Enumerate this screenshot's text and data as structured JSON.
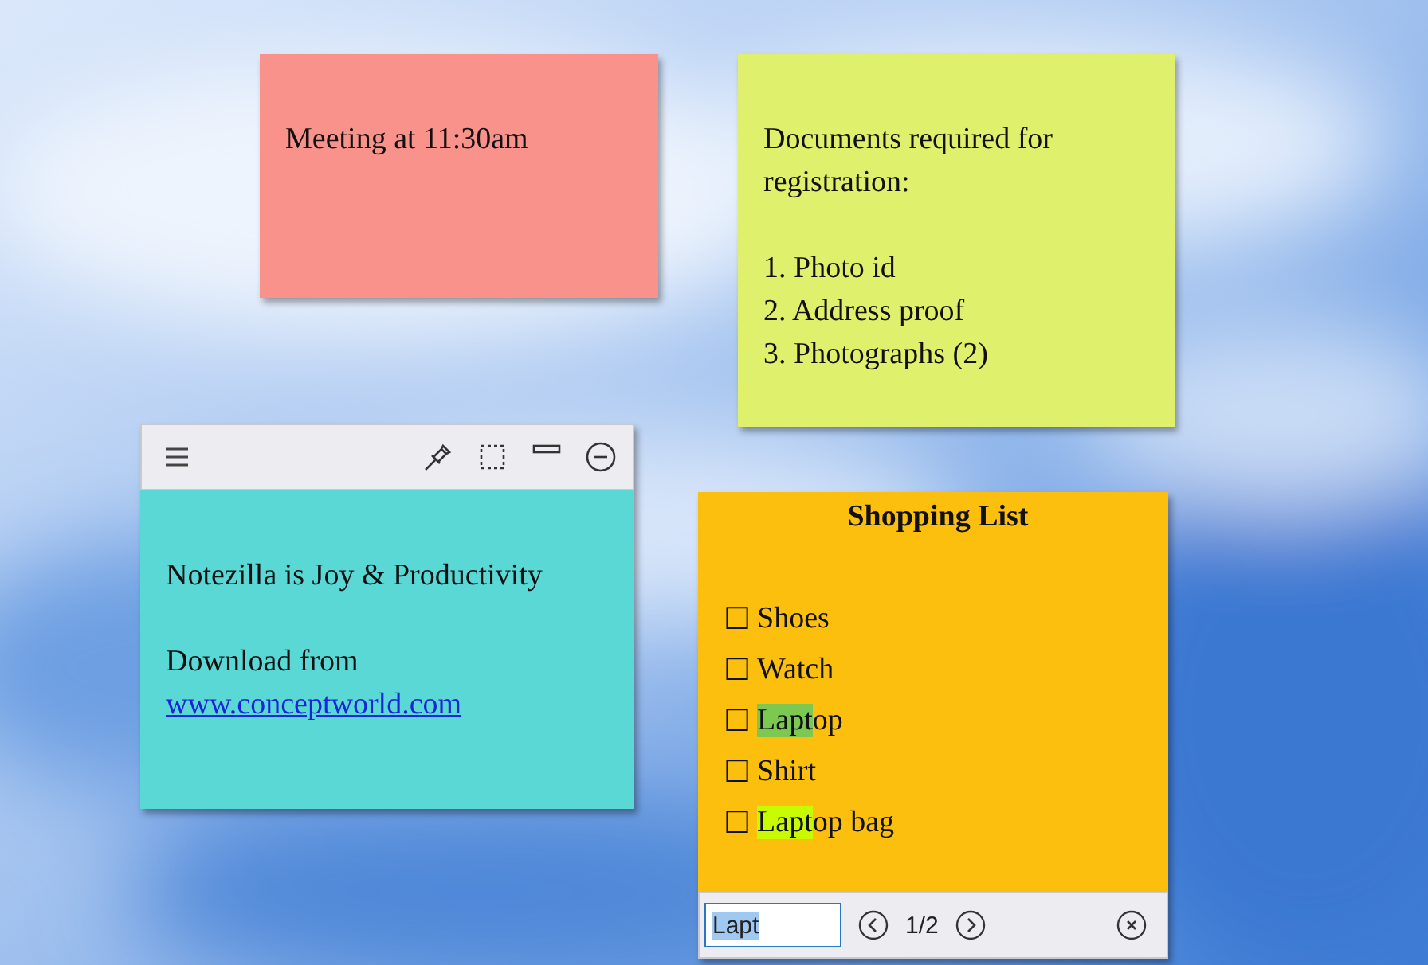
{
  "notes": [
    {
      "kind": "text",
      "color": "#f9928a",
      "paragraphs": [
        [
          "Meeting at 11:30am"
        ]
      ]
    },
    {
      "kind": "text",
      "color": "#dff16c",
      "paragraphs": [
        [
          "Documents required for registration:"
        ],
        [
          "1. Photo id",
          "2. Address proof",
          "3. Photographs (2)"
        ]
      ]
    },
    {
      "kind": "toolbar",
      "color": "#5ad8d6",
      "paragraphs": [
        [
          "Notezilla is Joy & Productivity"
        ],
        [
          "Download from"
        ]
      ],
      "link": "www.conceptworld.com"
    },
    {
      "kind": "checklist",
      "color": "#fdbf0e",
      "title": "Shopping List",
      "items": [
        {
          "box": "☐",
          "text": "Shoes"
        },
        {
          "box": "☐",
          "text": "Watch"
        },
        {
          "box": "☐",
          "match": "Lapt",
          "text": "op",
          "current": true
        },
        {
          "box": "☐",
          "text": "Shirt"
        },
        {
          "box": "☐",
          "match": "Lapt",
          "text": "op bag",
          "current": false
        }
      ],
      "find": {
        "value": "Lapt",
        "count": "1/2"
      }
    }
  ]
}
